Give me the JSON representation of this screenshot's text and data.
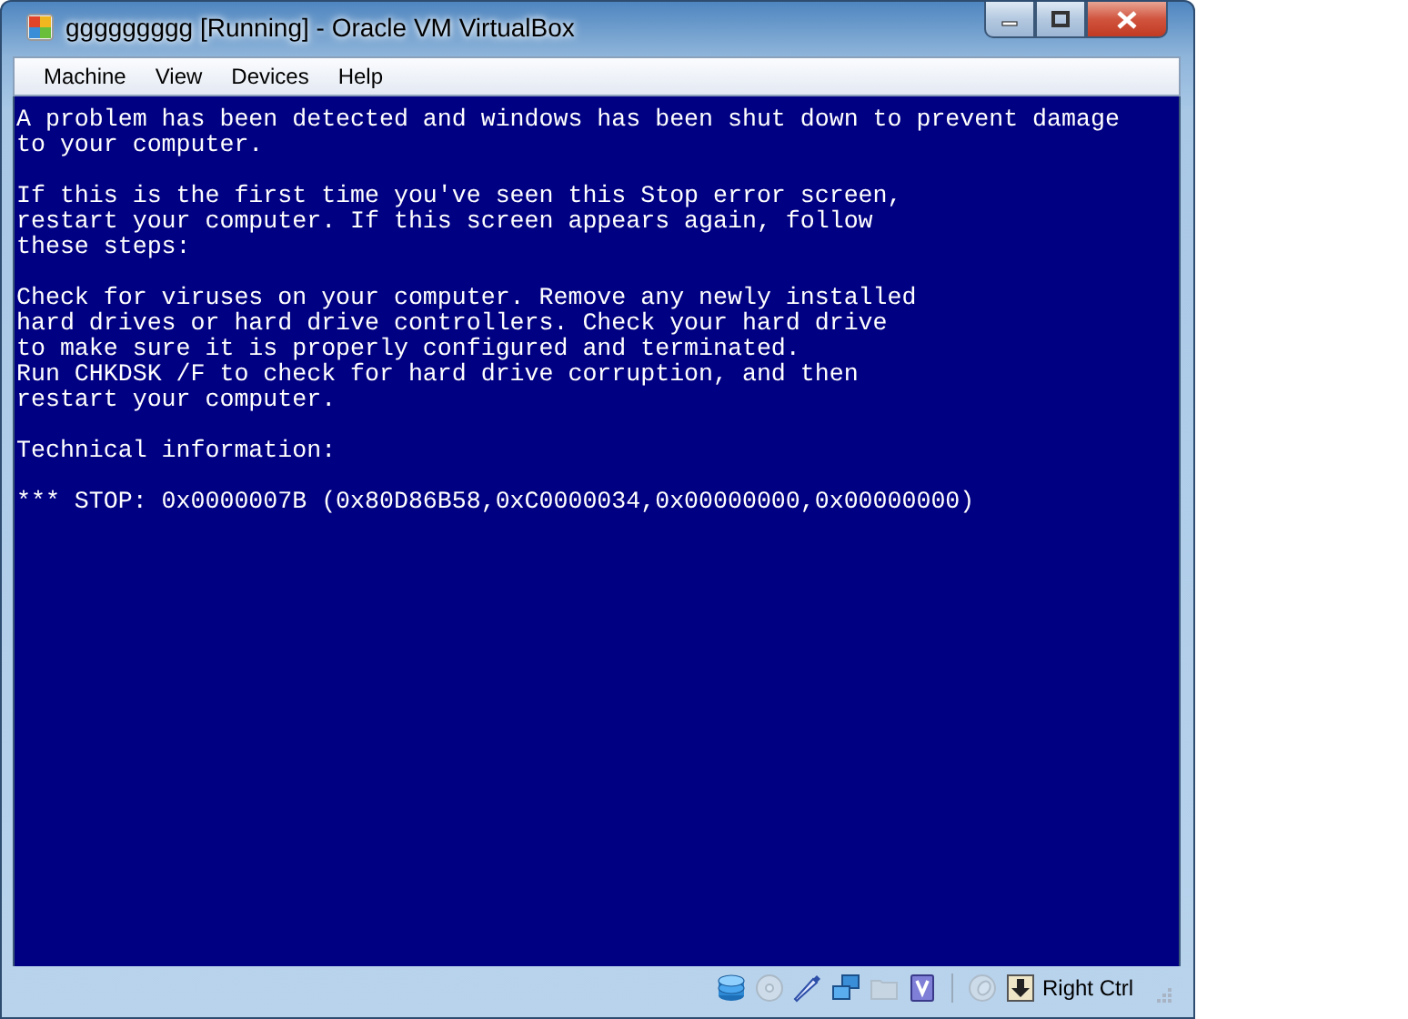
{
  "window": {
    "title": "ggggggggg [Running] - Oracle VM VirtualBox"
  },
  "menu": [
    "Machine",
    "View",
    "Devices",
    "Help"
  ],
  "screen": {
    "paragraphs": [
      "A problem has been detected and windows has been shut down to prevent damage\nto your computer.",
      "If this is the first time you've seen this Stop error screen,\nrestart your computer. If this screen appears again, follow\nthese steps:",
      "Check for viruses on your computer. Remove any newly installed\nhard drives or hard drive controllers. Check your hard drive\nto make sure it is properly configured and terminated.\nRun CHKDSK /F to check for hard drive corruption, and then\nrestart your computer.",
      "Technical information:",
      "*** STOP: 0x0000007B (0x80D86B58,0xC0000034,0x00000000,0x00000000)"
    ]
  },
  "status_bar": {
    "indicators": [
      {
        "kind": "hard-disk",
        "active": true
      },
      {
        "kind": "optical",
        "active": false
      },
      {
        "kind": "usb",
        "active": true
      },
      {
        "kind": "network",
        "active": true
      },
      {
        "kind": "shared-folder",
        "active": false
      },
      {
        "kind": "virtualization",
        "active": true
      },
      {
        "kind": "separator"
      },
      {
        "kind": "mouse",
        "active": false
      },
      {
        "kind": "host-key",
        "active": true
      }
    ],
    "host_key": "Right Ctrl"
  }
}
